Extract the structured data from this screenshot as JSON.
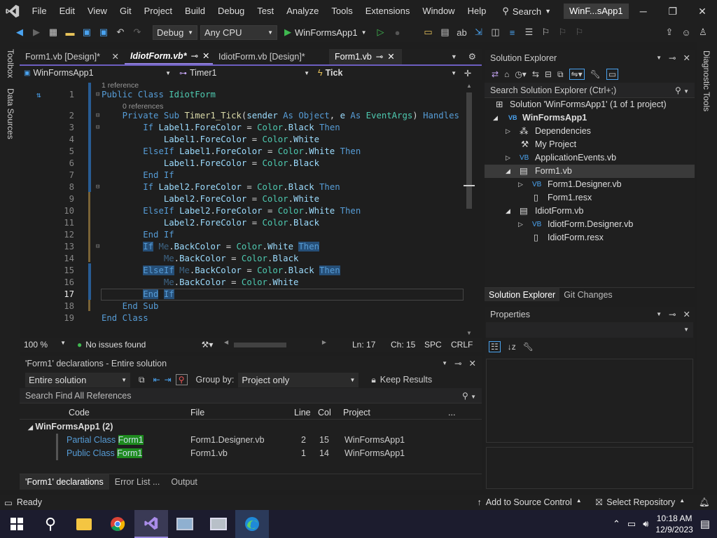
{
  "menubar": {
    "items": [
      "File",
      "Edit",
      "View",
      "Git",
      "Project",
      "Build",
      "Debug",
      "Test",
      "Analyze",
      "Tools",
      "Extensions",
      "Window",
      "Help"
    ],
    "search_label": "Search",
    "solution_name": "WinF...sApp1"
  },
  "toolbar": {
    "config": "Debug",
    "platform": "Any CPU",
    "run_target": "WinFormsApp1"
  },
  "side": {
    "toolbox": "Toolbox",
    "data_sources": "Data Sources",
    "diagnostic_tools": "Diagnostic Tools"
  },
  "tabs": [
    {
      "label": "Form1.vb [Design]*"
    },
    {
      "label": "IdiotForm.vb*"
    },
    {
      "label": "IdiotForm.vb [Design]*"
    },
    {
      "label": "Form1.vb"
    }
  ],
  "navbar": {
    "project": "WinFormsApp1",
    "class": "Timer1",
    "member": "Tick"
  },
  "code": {
    "ref1": "1 reference",
    "ref0": "0 references",
    "lines": [
      {
        "n": "1"
      },
      {
        "n": "2"
      },
      {
        "n": "3"
      },
      {
        "n": "4"
      },
      {
        "n": "5"
      },
      {
        "n": "6"
      },
      {
        "n": "7"
      },
      {
        "n": "8"
      },
      {
        "n": "9"
      },
      {
        "n": "10"
      },
      {
        "n": "11"
      },
      {
        "n": "12"
      },
      {
        "n": "13"
      },
      {
        "n": "14"
      },
      {
        "n": "15"
      },
      {
        "n": "16"
      },
      {
        "n": "17"
      },
      {
        "n": "18"
      },
      {
        "n": "19"
      }
    ]
  },
  "editor_status": {
    "zoom": "100 %",
    "issues": "No issues found",
    "line": "Ln: 17",
    "col": "Ch: 15",
    "spc": "SPC",
    "eol": "CRLF"
  },
  "find": {
    "title": "'Form1' declarations - Entire solution",
    "scope": "Entire solution",
    "group_by_label": "Group by:",
    "group_by": "Project only",
    "keep_results": "Keep Results",
    "search_placeholder": "Search Find All References",
    "columns": [
      "Code",
      "File",
      "Line",
      "Col",
      "Project",
      "..."
    ],
    "group": "WinFormsApp1  (2)",
    "rows": [
      {
        "code_pre": "Partial Class ",
        "match": "Form1",
        "file": "Form1.Designer.vb",
        "line": "2",
        "col": "15",
        "project": "WinFormsApp1"
      },
      {
        "code_pre": "Public Class ",
        "match": "Form1",
        "file": "Form1.vb",
        "line": "1",
        "col": "14",
        "project": "WinFormsApp1"
      }
    ],
    "tabs": [
      "'Form1' declarations",
      "Error List ...",
      "Output"
    ]
  },
  "solution_explorer": {
    "title": "Solution Explorer",
    "search_placeholder": "Search Solution Explorer (Ctrl+;)",
    "items": [
      {
        "label": "Solution 'WinFormsApp1' (1 of 1 project)"
      },
      {
        "label": "WinFormsApp1"
      },
      {
        "label": "Dependencies"
      },
      {
        "label": "My Project"
      },
      {
        "label": "ApplicationEvents.vb"
      },
      {
        "label": "Form1.vb"
      },
      {
        "label": "Form1.Designer.vb"
      },
      {
        "label": "Form1.resx"
      },
      {
        "label": "IdiotForm.vb"
      },
      {
        "label": "IdiotForm.Designer.vb"
      },
      {
        "label": "IdiotForm.resx"
      }
    ],
    "bottom_tabs": [
      "Solution Explorer",
      "Git Changes"
    ]
  },
  "properties": {
    "title": "Properties"
  },
  "statusbar": {
    "ready": "Ready",
    "source_control": "Add to Source Control",
    "repo": "Select Repository"
  },
  "taskbar": {
    "time": "10:18 AM",
    "date": "12/9/2023"
  },
  "colors": {
    "accent": "#8f7ed8",
    "match": "#1e8a1e",
    "keyword": "#569cd6",
    "type": "#4ec9b0"
  }
}
